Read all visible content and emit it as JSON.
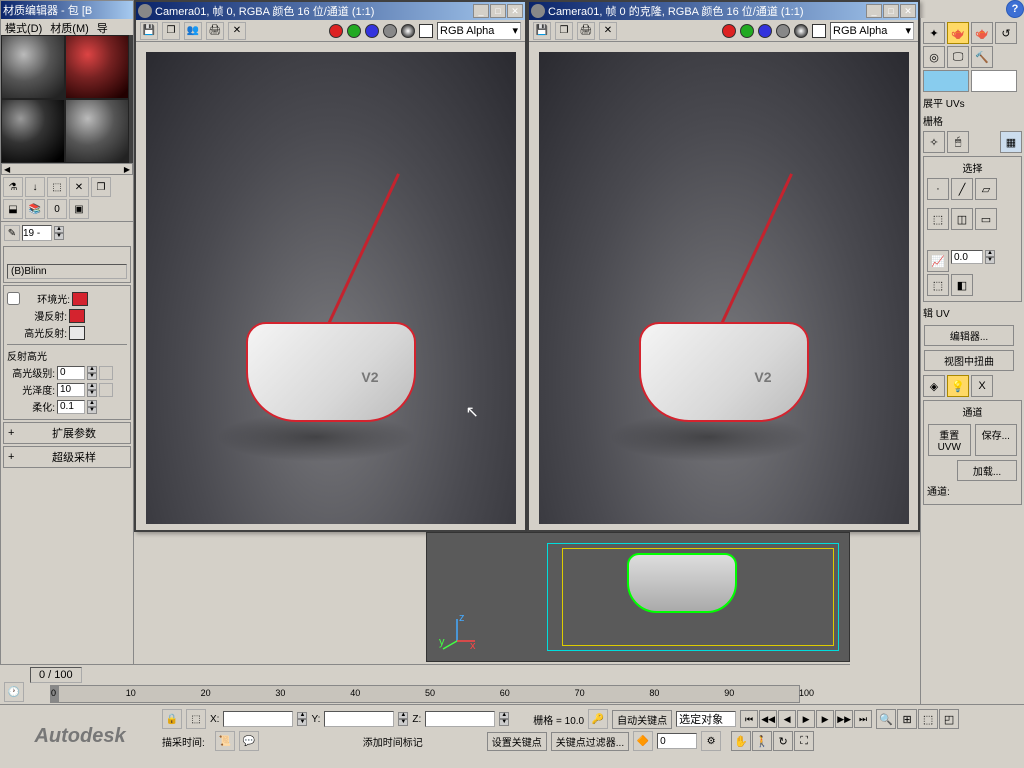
{
  "material_editor": {
    "title": "材质编辑器 - 包 [B",
    "menu": {
      "mode": "模式(D)",
      "material": "材质(M)",
      "nav": "导"
    },
    "name_field": "19 -",
    "shader": "(B)Blinn",
    "ambient": "环境光:",
    "diffuse": "漫反射:",
    "specular": "高光反射:",
    "colors": {
      "ambient": "#d4232e",
      "diffuse": "#d4232e",
      "specular": "#e8e8e8"
    },
    "reflection_header": "反射高光",
    "spec_level_label": "高光级别:",
    "spec_level": "0",
    "glossiness_label": "光泽度:",
    "glossiness": "10",
    "soften_label": "柔化:",
    "soften": "0.1",
    "rollup1": "扩展参数",
    "rollup2": "超级采样"
  },
  "render_left": {
    "title": "Camera01, 帧 0, RGBA 颜色 16 位/通道 (1:1)",
    "mode": "RGB Alpha"
  },
  "render_right": {
    "title": "Camera01, 帧 0 的克隆, RGBA 颜色 16 位/通道 (1:1)",
    "mode": "RGB Alpha"
  },
  "right_panel": {
    "uvs_label": "展平 UVs",
    "grid_label": "栅格",
    "select_header": "选择",
    "spinner_val": "0.0",
    "edit_uv_label": "辑 UV",
    "editor_label": "编辑器...",
    "viewport_distort": "视图中扭曲",
    "x_label": "X",
    "channel_header": "通道",
    "reset_uvw": "重置 UVW",
    "save": "保存...",
    "load": "加载...",
    "channel_label": "通道:"
  },
  "timeline": {
    "frame_display": "0 / 100",
    "ticks": [
      "0",
      "10",
      "20",
      "30",
      "40",
      "50",
      "60",
      "70",
      "80",
      "90",
      "100"
    ]
  },
  "status": {
    "brand": "Autodesk",
    "x_label": "X:",
    "y_label": "Y:",
    "z_label": "Z:",
    "grid_label": "栅格 = 10.0",
    "add_time_tag": "添加时间标记",
    "auto_key": "自动关键点",
    "set_key": "设置关键点",
    "selected": "选定对象",
    "key_filter": "关键点过滤器...",
    "frame_input": "0",
    "sample_label": "描采时间:"
  },
  "help": "?"
}
